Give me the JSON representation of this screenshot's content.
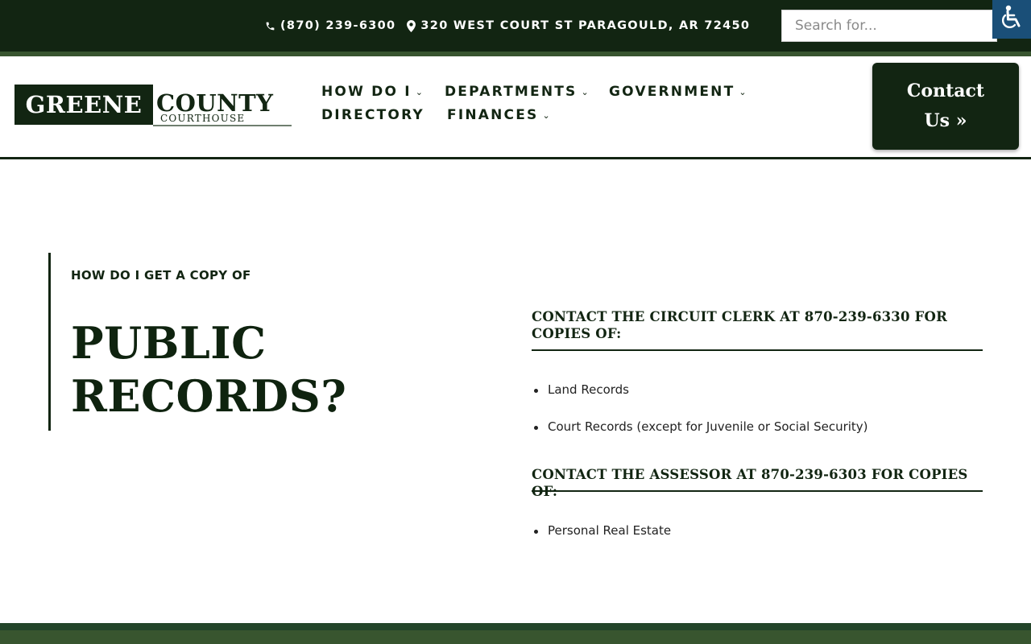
{
  "topbar": {
    "phone": "(870) 239-6300",
    "address": "320 WEST COURT ST PARAGOULD, AR 72450",
    "search_placeholder": "Search for..."
  },
  "logo": {
    "word1": "GREENE",
    "word2": "COUNTY",
    "sub": "COURTHOUSE"
  },
  "nav": {
    "items": [
      {
        "label": "HOW DO I",
        "dropdown": true
      },
      {
        "label": "DEPARTMENTS",
        "dropdown": true
      },
      {
        "label": "GOVERNMENT",
        "dropdown": true
      },
      {
        "label": "DIRECTORY",
        "dropdown": false
      },
      {
        "label": "FINANCES",
        "dropdown": true
      }
    ],
    "chevron": "⌄"
  },
  "contact_button": {
    "line1": "Contact",
    "line2": "Us »"
  },
  "hero": {
    "eyebrow": "HOW DO I GET A COPY OF",
    "title_line1": "PUBLIC",
    "title_line2": "RECORDS?"
  },
  "sections": [
    {
      "heading": "CONTACT THE CIRCUIT CLERK AT 870-239-6330 FOR COPIES OF:",
      "items": [
        "Land Records",
        "Court Records (except for Juvenile or Social Security)"
      ]
    },
    {
      "heading": "CONTACT THE ASSESSOR AT 870-239-6303 FOR COPIES OF:",
      "items": [
        "Personal Real Estate"
      ]
    }
  ],
  "colors": {
    "dark_green": "#122512",
    "mid_green": "#38552f",
    "accessibility_blue": "#1a4f78"
  },
  "icons": {
    "phone": "phone-icon",
    "location": "map-marker-icon",
    "accessibility": "wheelchair-icon"
  }
}
